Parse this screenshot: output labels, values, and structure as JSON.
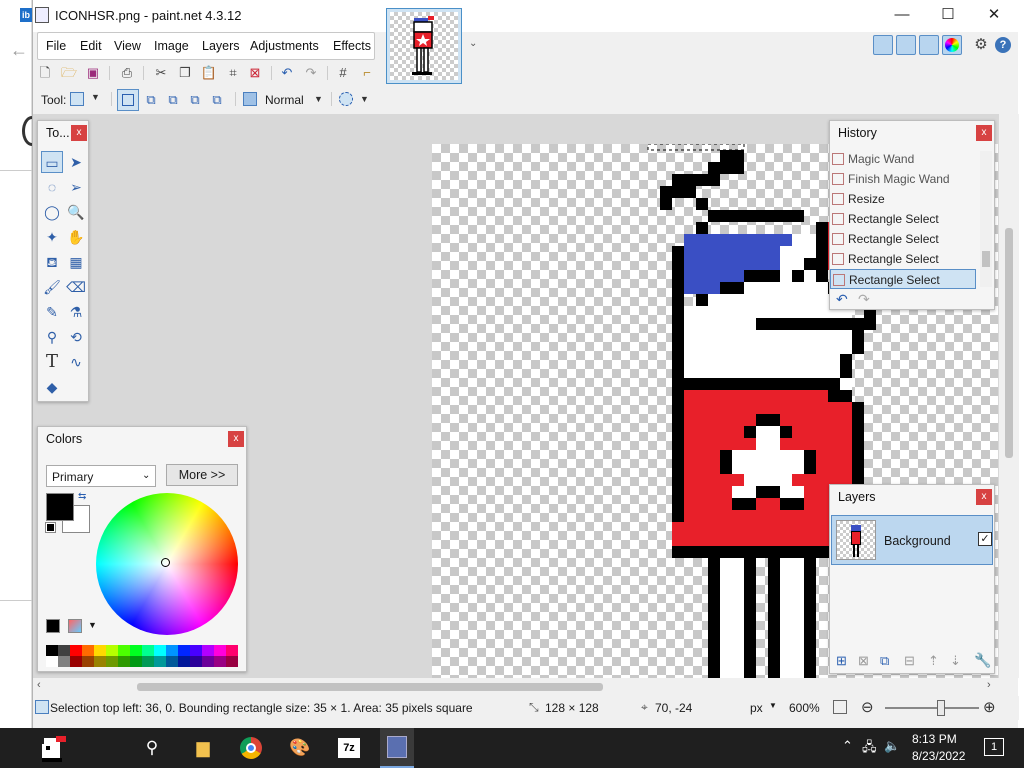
{
  "window": {
    "title": "ICONHSR.png - paint.net 4.3.12",
    "minimize_glyph": "—",
    "maximize_glyph": "☐",
    "close_glyph": "✕"
  },
  "menu": [
    "File",
    "Edit",
    "View",
    "Image",
    "Layers",
    "Adjustments",
    "Effects"
  ],
  "toolbar": {
    "tool_label": "Tool:",
    "blend_mode": "Normal"
  },
  "tools_panel": {
    "title": "To...",
    "close": "x",
    "icons": [
      "rectangle-select-icon",
      "move-selection-icon",
      "lasso-select-icon",
      "move-selected-icon",
      "ellipse-select-icon",
      "zoom-icon",
      "magic-wand-icon",
      "pan-icon",
      "paint-bucket-icon",
      "gradient-icon",
      "paintbrush-icon",
      "eraser-icon",
      "pencil-icon",
      "color-picker-icon",
      "clone-stamp-icon",
      "recolor-icon",
      "text-icon",
      "line-curve-icon",
      "shapes-icon"
    ]
  },
  "colors_panel": {
    "title": "Colors",
    "close": "x",
    "primary_select": "Primary",
    "more_button": "More >>",
    "primary_color": "#000000",
    "secondary_color": "#ffffff",
    "palette": [
      "#000000",
      "#404040",
      "#ff0000",
      "#ff6a00",
      "#ffd800",
      "#b6ff00",
      "#4cff00",
      "#00ff21",
      "#00ff90",
      "#00ffff",
      "#0094ff",
      "#0026ff",
      "#4800ff",
      "#b200ff",
      "#ff00dc",
      "#ff006e"
    ]
  },
  "history_panel": {
    "title": "History",
    "close": "x",
    "items": [
      "Magic Wand",
      "Finish Magic Wand",
      "Resize",
      "Rectangle Select",
      "Rectangle Select",
      "Rectangle Select",
      "Rectangle Select"
    ],
    "selected_index": 6
  },
  "layers_panel": {
    "title": "Layers",
    "close": "x",
    "layer_name": "Background",
    "visible": true
  },
  "status": {
    "selection_text": "Selection top left: 36, 0. Bounding rectangle size: 35 × 1. Area: 35 pixels square",
    "image_size": "128 × 128",
    "cursor_pos": "70, -24",
    "units": "px",
    "zoom": "600%"
  },
  "taskbar": {
    "time": "8:13 PM",
    "date": "8/23/2022",
    "notifications": "1"
  },
  "colors": {
    "accent": "#4a90c8",
    "titlebar": "#ffffff",
    "panel_close": "#d74242",
    "pixel_red": "#e8202a",
    "pixel_blue": "#3a4fc4"
  }
}
